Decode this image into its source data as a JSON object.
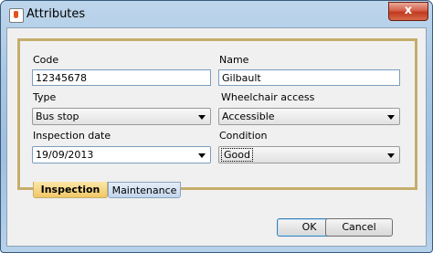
{
  "window": {
    "title": "Attributes",
    "close_label": "x"
  },
  "form": {
    "code_label": "Code",
    "code_value": "12345678",
    "name_label": "Name",
    "name_value": "Gilbault",
    "type_label": "Type",
    "type_value": "Bus stop",
    "wheelchair_label": "Wheelchair access",
    "wheelchair_value": "Accessible",
    "inspection_date_label": "Inspection date",
    "inspection_date_value": "19/09/2013",
    "condition_label": "Condition",
    "condition_value": "Good"
  },
  "tabs": [
    {
      "label": "Inspection",
      "selected": true
    },
    {
      "label": "Maintenance",
      "selected": false
    }
  ],
  "buttons": {
    "ok": "OK",
    "cancel": "Cancel"
  }
}
